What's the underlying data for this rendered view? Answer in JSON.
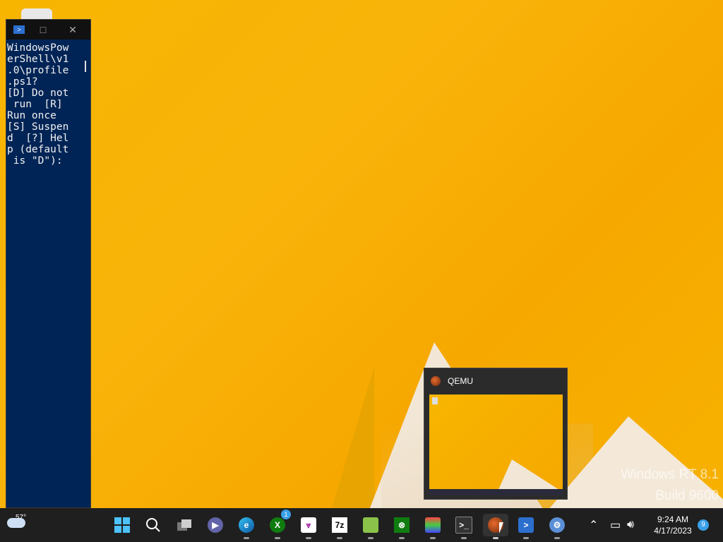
{
  "desktop": {
    "watermark_line1": "Windows RT 8.1",
    "watermark_line2": "Build 9600"
  },
  "powershell": {
    "text": "WindowsPow\nerShell\\v1\n.0\\profile\n.ps1?\n[D] Do not\n run  [R]\nRun once\n[S] Suspen\nd  [?] Hel\np (default\n is \"D\"):"
  },
  "thumbnail": {
    "title": "QEMU"
  },
  "taskbar": {
    "weather_temp": "57°",
    "xbox_badge": "1",
    "sevenzip_label": "7z",
    "clock_time": "9:24 AM",
    "clock_date": "4/17/2023",
    "notification_count": "9"
  },
  "colors": {
    "powershell_bg": "#012456",
    "taskbar_bg": "#1f1f1f",
    "accent": "#3aa0e8"
  }
}
